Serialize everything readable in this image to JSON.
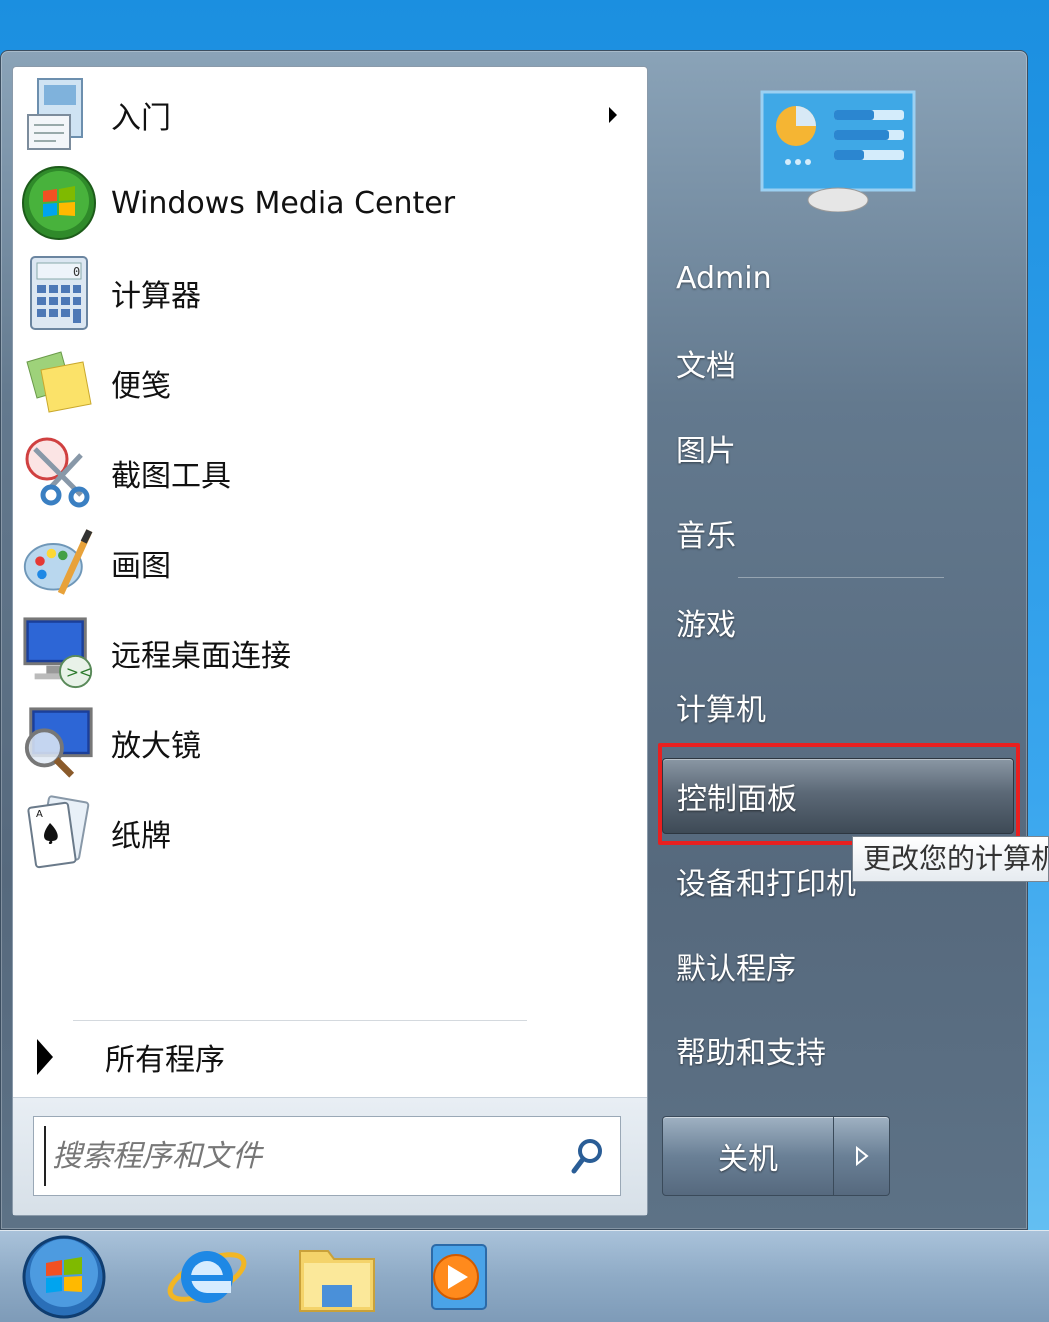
{
  "programs": [
    {
      "label": "入门",
      "icon": "getting-started-icon",
      "has_arrow": true
    },
    {
      "label": "Windows Media Center",
      "icon": "windows-media-center-icon"
    },
    {
      "label": "计算器",
      "icon": "calculator-icon"
    },
    {
      "label": "便笺",
      "icon": "sticky-notes-icon"
    },
    {
      "label": "截图工具",
      "icon": "snipping-tool-icon"
    },
    {
      "label": "画图",
      "icon": "paint-icon"
    },
    {
      "label": "远程桌面连接",
      "icon": "remote-desktop-icon"
    },
    {
      "label": "放大镜",
      "icon": "magnifier-icon"
    },
    {
      "label": "纸牌",
      "icon": "solitaire-icon"
    }
  ],
  "all_programs": "所有程序",
  "search": {
    "placeholder": "搜索程序和文件"
  },
  "right_items": [
    {
      "label": "Admin"
    },
    {
      "label": "文档"
    },
    {
      "label": "图片"
    },
    {
      "label": "音乐"
    },
    {
      "label": "游戏"
    },
    {
      "label": "计算机"
    },
    {
      "label": "控制面板",
      "hovered": true
    },
    {
      "label": "设备和打印机"
    },
    {
      "label": "默认程序"
    },
    {
      "label": "帮助和支持"
    }
  ],
  "tooltip": "更改您的计算机",
  "shutdown": {
    "label": "关机"
  },
  "taskbar": [
    "start-orb-icon",
    "internet-explorer-icon",
    "windows-explorer-icon",
    "media-player-icon"
  ],
  "colors": {
    "highlight": "#e82020"
  }
}
